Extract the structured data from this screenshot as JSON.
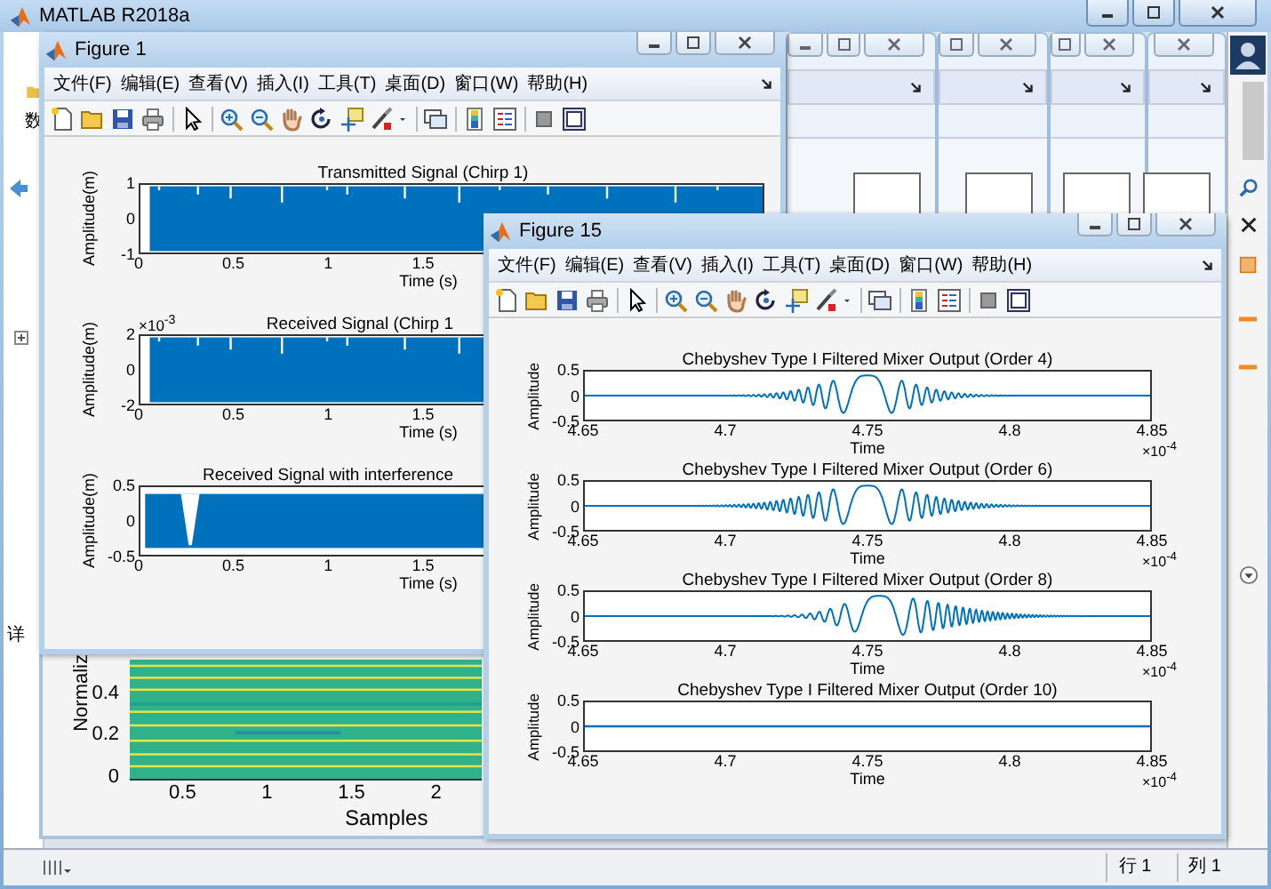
{
  "main_window": {
    "title": "MATLAB R2018a",
    "side_labels": [
      "数",
      "详"
    ],
    "status_bar": {
      "row": "行 1",
      "column": "列 1"
    }
  },
  "heatmap_figure": {
    "ylabel": "Normaliz",
    "yticks": [
      "0.4",
      "0.2",
      "0"
    ],
    "xticks": [
      "0.5",
      "1",
      "1.5",
      "2"
    ],
    "xlabel": "Samples"
  },
  "figures": [
    {
      "title": "Figure 1",
      "menu": [
        "文件(F)",
        "编辑(E)",
        "查看(V)",
        "插入(I)",
        "工具(T)",
        "桌面(D)",
        "窗口(W)",
        "帮助(H)"
      ],
      "plots": [
        {
          "title": "Transmitted Signal (Chirp 1)",
          "ylabel": "Amplitude(m)",
          "yticks": [
            "1",
            "0",
            "-1"
          ],
          "xticks": [
            "0",
            "0.5",
            "1",
            "1.5"
          ],
          "xlabel": "Time (s)",
          "kind": "dense"
        },
        {
          "title": "Received Signal (Chirp 1",
          "y_multiplier": "×10$^{-3}$",
          "ylabel": "Amplitude(m)",
          "yticks": [
            "2",
            "0",
            "-2"
          ],
          "xticks": [
            "0",
            "0.5",
            "1",
            "1.5"
          ],
          "xlabel": "Time (s)",
          "kind": "dense"
        },
        {
          "title": "Received Signal with interference",
          "ylabel": "Amplitude(m)",
          "yticks": [
            "0.5",
            "0",
            "-0.5"
          ],
          "xticks": [
            "0",
            "0.5",
            "1",
            "1.5"
          ],
          "xlabel": "Time (s)",
          "kind": "notched"
        }
      ]
    },
    {
      "title": "Figure 15",
      "menu": [
        "文件(F)",
        "编辑(E)",
        "查看(V)",
        "插入(I)",
        "工具(T)",
        "桌面(D)",
        "窗口(W)",
        "帮助(H)"
      ],
      "plots": [
        {
          "title": "Chebyshev Type I Filtered Mixer Output (Order 4)",
          "ylabel": "Amplitude",
          "yticks": [
            "0.5",
            "0",
            "-0.5"
          ],
          "xticks": [
            "4.65",
            "4.7",
            "4.75",
            "4.8",
            "4.85"
          ],
          "xlabel": "Time",
          "x_multiplier": "×10$^{-4}$",
          "kind": "burst"
        },
        {
          "title": "Chebyshev Type I Filtered Mixer Output (Order 6)",
          "ylabel": "Amplitude",
          "yticks": [
            "0.5",
            "0",
            "-0.5"
          ],
          "xticks": [
            "4.65",
            "4.7",
            "4.75",
            "4.8",
            "4.85"
          ],
          "xlabel": "Time",
          "x_multiplier": "×10$^{-4}$",
          "kind": "burst_wide"
        },
        {
          "title": "Chebyshev Type I Filtered Mixer Output (Order 8)",
          "ylabel": "Amplitude",
          "yticks": [
            "0.5",
            "0",
            "-0.5"
          ],
          "xticks": [
            "4.65",
            "4.7",
            "4.75",
            "4.8",
            "4.85"
          ],
          "xlabel": "Time",
          "x_multiplier": "×10$^{-4}$",
          "kind": "burst_late"
        },
        {
          "title": "Chebyshev Type I Filtered Mixer Output (Order 10)",
          "ylabel": "Amplitude",
          "yticks": [
            "0.5",
            "0",
            "-0.5"
          ],
          "xticks": [
            "4.65",
            "4.7",
            "4.75",
            "4.8",
            "4.85"
          ],
          "xlabel": "Time",
          "x_multiplier": "×10$^{-4}$",
          "kind": "flat"
        }
      ]
    }
  ]
}
